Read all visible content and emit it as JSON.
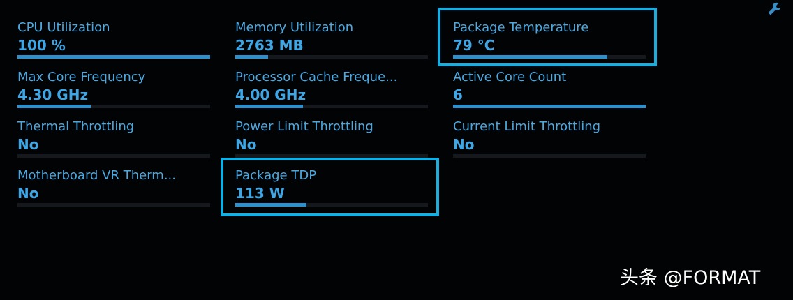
{
  "colors": {
    "background": "#020304",
    "label": "#4ba8e0",
    "value": "#3fa6e6",
    "bar_fill": "#2e8fcd",
    "bar_track": "#15191e",
    "highlight_border": "#18aee0",
    "watermark": "#ffffff"
  },
  "toolbar": {
    "settings_icon": "wrench-icon"
  },
  "metrics": [
    {
      "label": "CPU Utilization",
      "value": "100 %",
      "level": 1.0
    },
    {
      "label": "Memory Utilization",
      "value": "2763  MB",
      "level": 0.17
    },
    {
      "label": "Package Temperature",
      "value": "79 °C",
      "level": 0.8,
      "highlighted": true
    },
    {
      "label": "Max Core Frequency",
      "value": "4.30 GHz",
      "level": 0.38
    },
    {
      "label": "Processor Cache Freque...",
      "value": "4.00 GHz",
      "level": 0.35
    },
    {
      "label": "Active Core Count",
      "value": "6",
      "level": 1.0
    },
    {
      "label": "Thermal Throttling",
      "value": "No",
      "level": 0
    },
    {
      "label": "Power Limit Throttling",
      "value": "No",
      "level": 0
    },
    {
      "label": "Current Limit Throttling",
      "value": "No",
      "level": 0
    },
    {
      "label": "Motherboard VR Therm...",
      "value": "No",
      "level": 0
    },
    {
      "label": "Package TDP",
      "value": "113 W",
      "level": 0.37,
      "highlighted": true
    }
  ],
  "watermark": {
    "text": "头条 @FORMAT"
  }
}
